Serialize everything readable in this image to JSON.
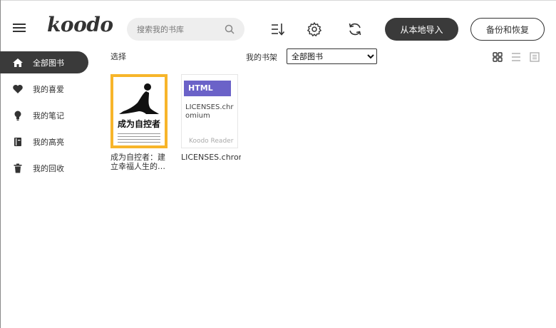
{
  "header": {
    "logo": "koodo",
    "search_placeholder": "搜索我的书库",
    "import_button": "从本地导入",
    "backup_button": "备份和恢复",
    "icons": [
      "menu-icon",
      "sort-icon",
      "gear-icon",
      "sync-icon",
      "search-icon"
    ]
  },
  "sidebar": {
    "items": [
      {
        "label": "全部图书",
        "icon": "home-icon",
        "active": true
      },
      {
        "label": "我的喜爱",
        "icon": "heart-icon",
        "active": false
      },
      {
        "label": "我的笔记",
        "icon": "bulb-icon",
        "active": false
      },
      {
        "label": "我的高亮",
        "icon": "notebook-icon",
        "active": false
      },
      {
        "label": "我的回收",
        "icon": "trash-icon",
        "active": false
      }
    ]
  },
  "toolbar": {
    "select_label": "选择",
    "shelf_label": "我的书架",
    "shelf_selected": "全部图书",
    "view_modes": [
      "grid-view-icon",
      "list-view-icon",
      "cover-view-icon"
    ]
  },
  "books": [
    {
      "title": "成为自控者：建立幸福人生的…",
      "cover_title": "成为自控者",
      "cover_color": "#f7b52a"
    },
    {
      "title": "LICENSES.chrom",
      "cover_format": "HTML",
      "cover_text": "LICENSES.chromium",
      "cover_brand": "Koodo Reader",
      "cover_color": "#6b62c8"
    }
  ]
}
